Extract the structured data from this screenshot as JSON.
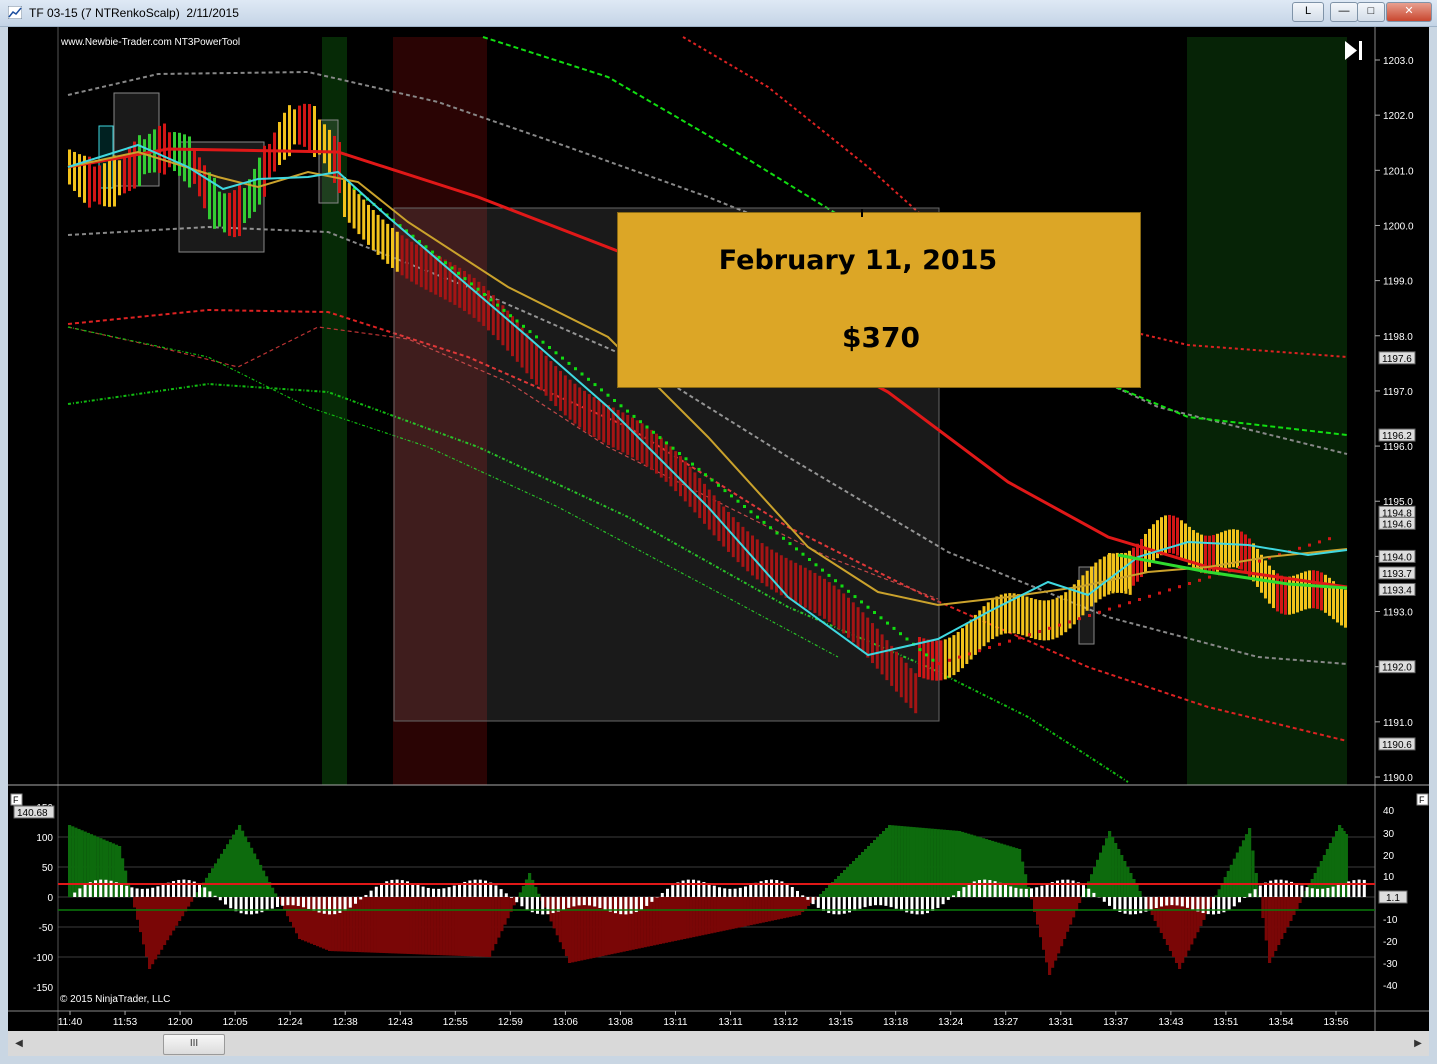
{
  "window": {
    "title": "TF 03-15 (7 NTRenkoScalp)  2/11/2015",
    "buttons": {
      "layout": "L",
      "minimize": "—",
      "maximize": "□",
      "close": "✕"
    }
  },
  "chart": {
    "watermark": "www.Newbie-Trader.com NT3PowerTool",
    "copyright": "© 2015 NinjaTrader, LLC",
    "goto_end_icon": "skip-to-end-icon",
    "price_axis": [
      "1203.0",
      "1202.0",
      "1201.0",
      "1200.0",
      "1199.0",
      "1198.0",
      "1197.0",
      "1196.0",
      "1195.0",
      "1194.0",
      "1193.0",
      "1192.0",
      "1191.0",
      "1190.0"
    ],
    "price_markers": [
      "1197.6",
      "1196.2",
      "1194.8",
      "1194.6",
      "1194.0",
      "1193.7",
      "1193.4",
      "1192.0",
      "1190.6"
    ],
    "time_axis": [
      "11:40",
      "11:53",
      "12:00",
      "12:05",
      "12:24",
      "12:38",
      "12:43",
      "12:55",
      "12:59",
      "13:06",
      "13:08",
      "13:11",
      "13:11",
      "13:12",
      "13:15",
      "13:18",
      "13:24",
      "13:27",
      "13:31",
      "13:37",
      "13:43",
      "13:51",
      "13:54",
      "13:56"
    ],
    "indicator_left_axis": [
      "150",
      "100",
      "50",
      "0",
      "-50",
      "-100",
      "-150"
    ],
    "indicator_right_axis": [
      "40",
      "30",
      "20",
      "10",
      "1",
      "-10",
      "-20",
      "-30",
      "-40"
    ],
    "indicator_left_marker": "140.68",
    "indicator_right_marker": "1.1",
    "panel_flag": "F"
  },
  "banner": {
    "date": "February 11, 2015",
    "amount": "$370"
  },
  "colors": {
    "background": "#000000",
    "up_bar": "#f2c21b",
    "down_bar": "#d21616",
    "ema_red": "#e01818",
    "signal_cyan": "#3fd8e0",
    "banner": "#dca626"
  },
  "scrollbar": {
    "thumb_label": "III"
  }
}
